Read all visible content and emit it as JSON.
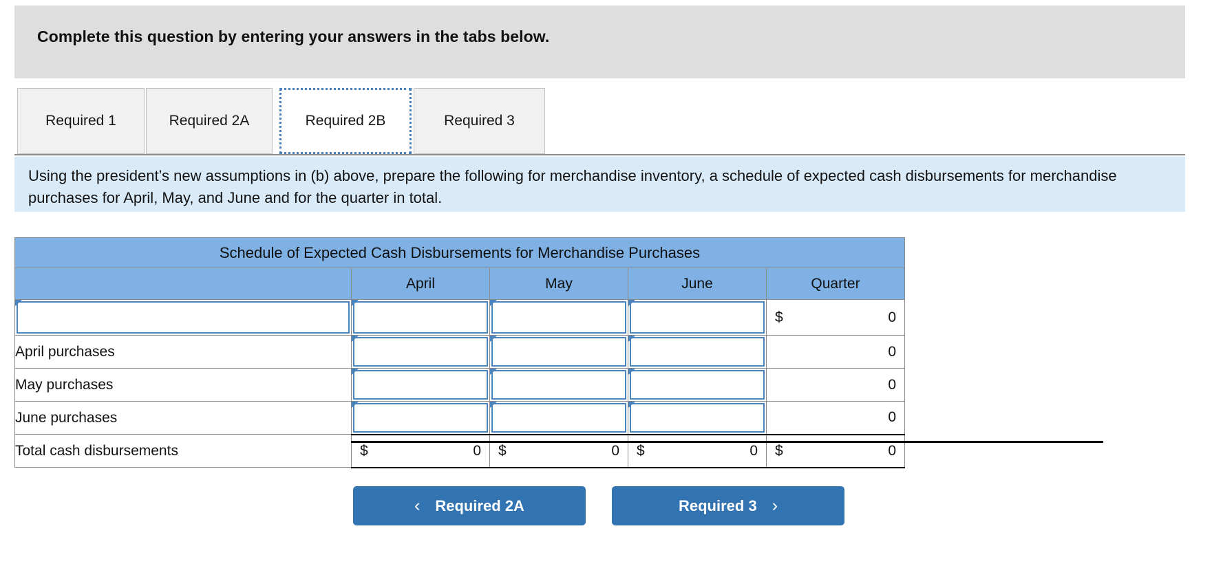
{
  "banner": {
    "text": "Complete this question by entering your answers in the tabs below."
  },
  "tabs": [
    {
      "label": "Required 1",
      "active": false
    },
    {
      "label": "Required 2A",
      "active": false
    },
    {
      "label": "Required 2B",
      "active": true
    },
    {
      "label": "Required 3",
      "active": false
    }
  ],
  "instruction": {
    "text": "Using the president’s new assumptions in (b) above, prepare the following for merchandise inventory, a schedule of expected cash disbursements for merchandise purchases for April, May, and June and for the quarter in total."
  },
  "schedule": {
    "title": "Schedule of Expected Cash Disbursements for Merchandise Purchases",
    "columns": [
      "",
      "April",
      "May",
      "June",
      "Quarter"
    ],
    "rows": [
      {
        "label": "",
        "april": "",
        "may": "",
        "june": "",
        "quarter_dollar": "$",
        "quarter_value": "0"
      },
      {
        "label": "April purchases",
        "april": "",
        "may": "",
        "june": "",
        "quarter_dollar": "",
        "quarter_value": "0"
      },
      {
        "label": "May purchases",
        "april": "",
        "may": "",
        "june": "",
        "quarter_dollar": "",
        "quarter_value": "0"
      },
      {
        "label": "June purchases",
        "april": "",
        "may": "",
        "june": "",
        "quarter_dollar": "",
        "quarter_value": "0"
      }
    ],
    "total": {
      "label": "Total cash disbursements",
      "april_dollar": "$",
      "april_value": "0",
      "may_dollar": "$",
      "may_value": "0",
      "june_dollar": "$",
      "june_value": "0",
      "quarter_dollar": "$",
      "quarter_value": "0"
    }
  },
  "nav": {
    "prev_label": "Required 2A",
    "prev_icon": "chevron-left-icon",
    "prev_glyph": "‹",
    "next_label": "Required 3",
    "next_icon": "chevron-right-icon",
    "next_glyph": "›"
  },
  "colors": {
    "banner_bg": "#dedede",
    "instruction_bg": "#d9eaf9",
    "table_header_blue": "#7fb1e5",
    "button_blue": "#3274b2",
    "input_border_blue": "#4a84bf"
  }
}
